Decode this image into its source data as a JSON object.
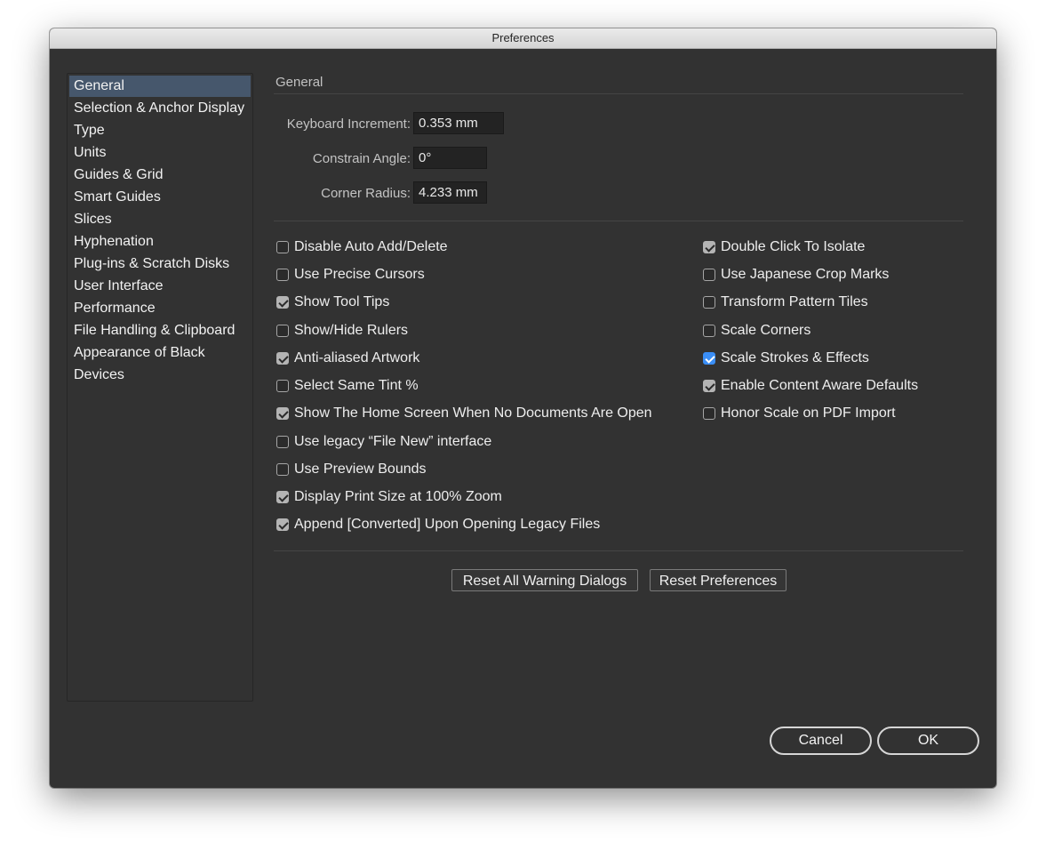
{
  "window": {
    "title": "Preferences"
  },
  "sidebar": {
    "items": [
      {
        "label": "General",
        "selected": true
      },
      {
        "label": "Selection & Anchor Display"
      },
      {
        "label": "Type"
      },
      {
        "label": "Units"
      },
      {
        "label": "Guides & Grid"
      },
      {
        "label": "Smart Guides"
      },
      {
        "label": "Slices"
      },
      {
        "label": "Hyphenation"
      },
      {
        "label": "Plug-ins & Scratch Disks"
      },
      {
        "label": "User Interface"
      },
      {
        "label": "Performance"
      },
      {
        "label": "File Handling & Clipboard"
      },
      {
        "label": "Appearance of Black"
      },
      {
        "label": "Devices"
      }
    ]
  },
  "main": {
    "section_title": "General",
    "fields": {
      "keyboard_increment": {
        "label": "Keyboard Increment:",
        "value": "0.353 mm"
      },
      "constrain_angle": {
        "label": "Constrain Angle:",
        "value": "0°"
      },
      "corner_radius": {
        "label": "Corner Radius:",
        "value": "4.233 mm"
      }
    },
    "left_options": [
      {
        "label": "Disable Auto Add/Delete",
        "checked": false
      },
      {
        "label": "Use Precise Cursors",
        "checked": false
      },
      {
        "label": "Show Tool Tips",
        "checked": true
      },
      {
        "label": "Show/Hide Rulers",
        "checked": false
      },
      {
        "label": "Anti-aliased Artwork",
        "checked": true
      },
      {
        "label": "Select Same Tint %",
        "checked": false
      },
      {
        "label": "Show The Home Screen When No Documents Are Open",
        "checked": true
      },
      {
        "label": "Use legacy “File New” interface",
        "checked": false
      },
      {
        "label": "Use Preview Bounds",
        "checked": false
      },
      {
        "label": "Display Print Size at 100% Zoom",
        "checked": true
      },
      {
        "label": "Append [Converted] Upon Opening Legacy Files",
        "checked": true
      }
    ],
    "right_options": [
      {
        "label": "Double Click To Isolate",
        "checked": true
      },
      {
        "label": "Use Japanese Crop Marks",
        "checked": false
      },
      {
        "label": "Transform Pattern Tiles",
        "checked": false
      },
      {
        "label": "Scale Corners",
        "checked": false
      },
      {
        "label": "Scale Strokes & Effects",
        "checked": true,
        "focused": true
      },
      {
        "label": "Enable Content Aware Defaults",
        "checked": true
      },
      {
        "label": "Honor Scale on PDF Import",
        "checked": false
      }
    ],
    "reset_warnings_label": "Reset All Warning Dialogs",
    "reset_prefs_label": "Reset Preferences"
  },
  "footer": {
    "cancel_label": "Cancel",
    "ok_label": "OK"
  },
  "colors": {
    "panel": "#323232",
    "selection": "#46576c",
    "accent_checkbox": "#3a8ef6"
  }
}
